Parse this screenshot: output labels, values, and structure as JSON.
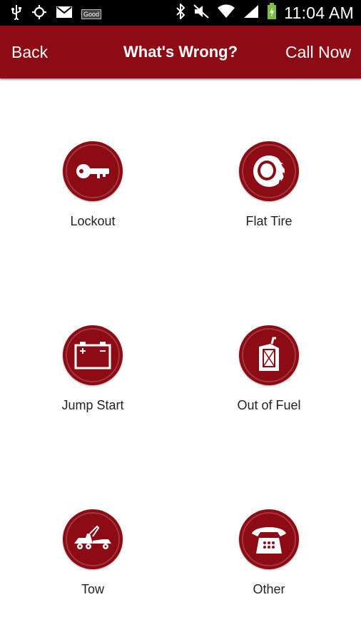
{
  "status_bar": {
    "time": "11:04 AM",
    "notification_badge": "Good",
    "icons_left": [
      "usb-icon",
      "gps-icon",
      "gmail-icon",
      "good-icon"
    ],
    "icons_right": [
      "bluetooth-icon",
      "vibrate-mute-icon",
      "wifi-icon",
      "signal-icon",
      "battery-charging-icon"
    ]
  },
  "app_bar": {
    "back_label": "Back",
    "title": "What's Wrong?",
    "call_label": "Call Now"
  },
  "colors": {
    "brand": "#8d0b14",
    "status_bar": "#000000",
    "background": "#ffffff"
  },
  "options": [
    {
      "label": "Lockout",
      "icon": "key-icon"
    },
    {
      "label": "Flat Tire",
      "icon": "tire-icon"
    },
    {
      "label": "Jump Start",
      "icon": "battery-icon"
    },
    {
      "label": "Out of Fuel",
      "icon": "fuel-can-icon"
    },
    {
      "label": "Tow",
      "icon": "tow-truck-icon"
    },
    {
      "label": "Other",
      "icon": "telephone-icon"
    }
  ]
}
